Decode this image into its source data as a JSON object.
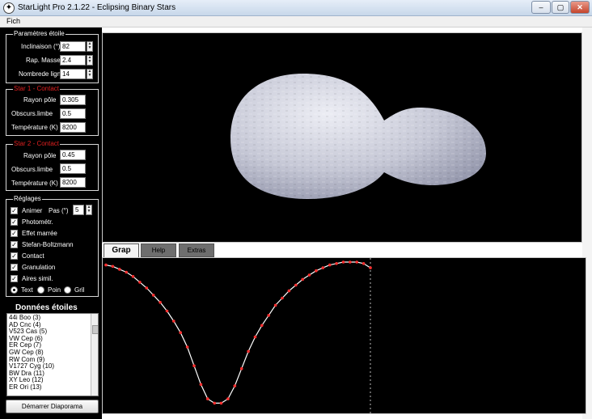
{
  "window": {
    "title": "StarLight Pro 2.1.22 - Eclipsing Binary Stars",
    "minimize_glyph": "–",
    "maximize_glyph": "▢",
    "close_glyph": "✕",
    "app_icon": "star-icon"
  },
  "menu": {
    "file_label": "Fich"
  },
  "parametres": {
    "label": "Paramètres étoile",
    "inclinaison_label": "Inclinaison (°)",
    "inclinaison_value": "82",
    "rap_masse_label": "Rap. Masse",
    "rap_masse_value": "2.4",
    "nombre_lignes_label": "Nombrede lign",
    "nombre_lignes_value": "14"
  },
  "star1": {
    "label": "Star 1 - Contact",
    "rayon_label": "Rayon pôle",
    "rayon_value": "0.305",
    "obscurs_label": "Obscurs.limbe",
    "obscurs_value": "0.5",
    "temperature_label": "Température (K)",
    "temperature_value": "8200"
  },
  "star2": {
    "label": "Star 2 - Contact",
    "rayon_label": "Rayon pôle",
    "rayon_value": "0.45",
    "obscurs_label": "Obscurs.limbe",
    "obscurs_value": "0.5",
    "temperature_label": "Température (K)",
    "temperature_value": "8200"
  },
  "reglages": {
    "label": "Réglages",
    "animer_label": "Animer",
    "pas_label": "Pas (°)",
    "pas_value": "5",
    "photometr_label": "Photométr.",
    "effet_maree_label": "Effet marrée",
    "stefan_label": "Stefan-Boltzmann",
    "contact_label": "Contact",
    "granulation_label": "Granulation",
    "aires_label": "Aires simil.",
    "radio_text_label": "Text",
    "radio_poin_label": "Poin",
    "radio_gril_label": "Gril",
    "check_glyph": "✓"
  },
  "donnees": {
    "title": "Données étoiles",
    "items": [
      "44i Boo (3)",
      "AD Cnc (4)",
      "V523 Cas (5)",
      "VW Cep (6)",
      "ER Cep (7)",
      "GW Cep (8)",
      "RW Com (9)",
      "V1727 Cyg (10)",
      "BW Dra (11)",
      "XY Leo (12)",
      "ER Ori (13)"
    ]
  },
  "demarrer_label": "Démarrer Diaporama",
  "tabs": {
    "grap": "Grap",
    "help": "Help",
    "extras": "Extras"
  },
  "colors": {
    "star_fill": "#d4d6e0",
    "curve_line": "#ffffff",
    "curve_point": "#ff3030",
    "background": "#000000"
  },
  "chart_data": {
    "type": "line",
    "x": [
      0,
      5,
      10,
      15,
      20,
      25,
      30,
      35,
      40,
      45,
      50,
      55,
      60,
      65,
      70,
      75,
      80,
      85,
      90,
      95,
      100,
      105,
      110,
      115,
      120,
      125,
      130,
      135,
      140,
      145,
      150,
      155,
      160,
      165,
      170,
      175,
      180,
      185,
      190,
      195
    ],
    "values": [
      0.98,
      0.97,
      0.95,
      0.93,
      0.9,
      0.86,
      0.82,
      0.77,
      0.72,
      0.66,
      0.59,
      0.51,
      0.41,
      0.28,
      0.15,
      0.05,
      0.02,
      0.02,
      0.05,
      0.14,
      0.26,
      0.38,
      0.48,
      0.56,
      0.63,
      0.7,
      0.75,
      0.8,
      0.84,
      0.88,
      0.91,
      0.94,
      0.96,
      0.98,
      0.99,
      1.0,
      1.0,
      1.0,
      0.99,
      0.96
    ],
    "marker_x": 195,
    "grid": false,
    "xlim": [
      0,
      195
    ],
    "ylim": [
      0,
      1
    ]
  }
}
